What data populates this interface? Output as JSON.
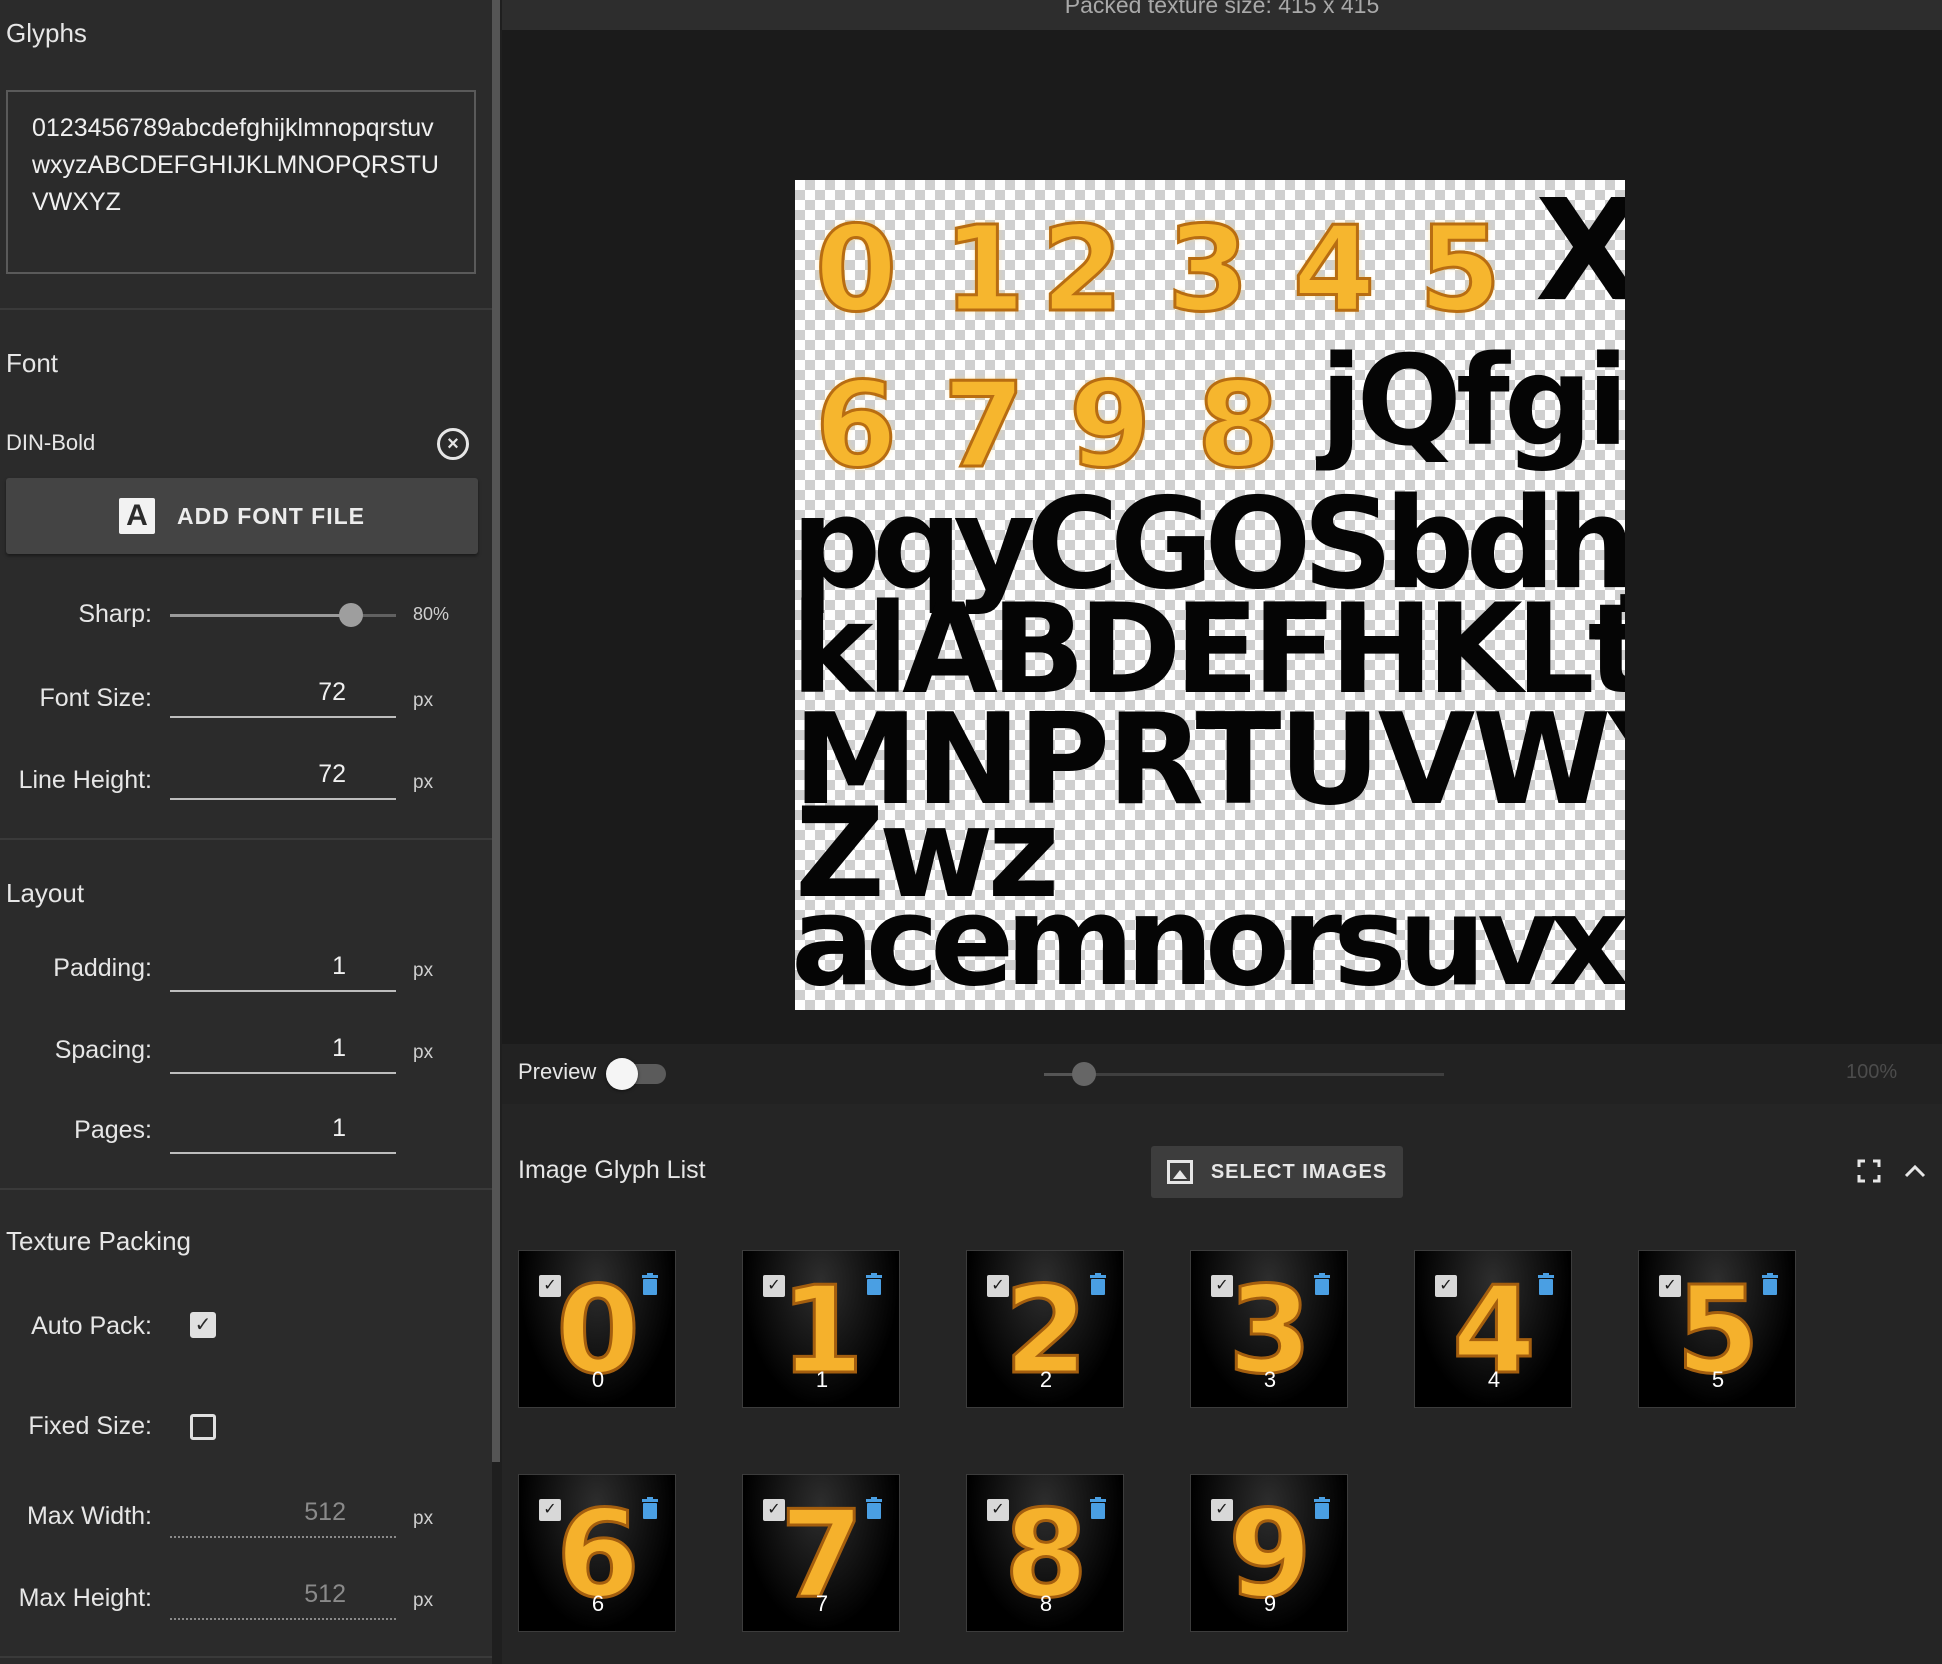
{
  "sidebar": {
    "glyphs": {
      "title": "Glyphs",
      "text": "0123456789abcdefghijklmnopqrstuvwxyzABCDEFGHIJKLMNOPQRSTUVWXYZ"
    },
    "font": {
      "title": "Font",
      "font_name": "DIN-Bold",
      "add_font_label": "ADD FONT FILE",
      "add_font_icon": "A",
      "sharp": {
        "label": "Sharp:",
        "value": "80%",
        "level": 0.8
      },
      "font_size": {
        "label": "Font Size:",
        "value": "72",
        "unit": "px"
      },
      "line_height": {
        "label": "Line Height:",
        "value": "72",
        "unit": "px"
      }
    },
    "layout": {
      "title": "Layout",
      "padding": {
        "label": "Padding:",
        "value": "1",
        "unit": "px"
      },
      "spacing": {
        "label": "Spacing:",
        "value": "1",
        "unit": "px"
      },
      "pages": {
        "label": "Pages:",
        "value": "1"
      }
    },
    "texture_packing": {
      "title": "Texture Packing",
      "auto_pack": {
        "label": "Auto Pack:",
        "checked": true
      },
      "fixed_size": {
        "label": "Fixed Size:",
        "checked": false
      },
      "max_width": {
        "label": "Max Width:",
        "value": "512",
        "unit": "px"
      },
      "max_height": {
        "label": "Max Height:",
        "value": "512",
        "unit": "px"
      }
    }
  },
  "preview": {
    "packed_size": "Packed texture size: 415 x 415",
    "texture_rows": {
      "row1_digits": [
        "0",
        "1",
        "2",
        "3",
        "4",
        "5"
      ],
      "row1_tail": "X",
      "row2_digits": [
        "6",
        "7",
        "9",
        "8"
      ],
      "row2_tail": "jQfgil",
      "row3": "pqyCGOSbdhJ",
      "row4": "klABDEFHKLt",
      "row5": "MNPRTUVWY",
      "row6": "Zwz",
      "row7": "acemnorsuvx"
    },
    "preview_label": "Preview",
    "preview_enabled": false,
    "zoom_label": "100%",
    "zoom_level": 0.1
  },
  "glyph_list": {
    "title": "Image Glyph List",
    "select_images_label": "SELECT IMAGES",
    "icons": {
      "select_images": "image-gallery-icon",
      "fullscreen": "fullscreen-icon",
      "collapse": "chevron-up-icon",
      "check": "checkbox-checked-icon",
      "delete": "trash-icon"
    },
    "accent_color": "#4a9fe3",
    "items": [
      {
        "char": "0",
        "label": "0",
        "checked": true
      },
      {
        "char": "1",
        "label": "1",
        "checked": true
      },
      {
        "char": "2",
        "label": "2",
        "checked": true
      },
      {
        "char": "3",
        "label": "3",
        "checked": true
      },
      {
        "char": "4",
        "label": "4",
        "checked": true
      },
      {
        "char": "5",
        "label": "5",
        "checked": true
      },
      {
        "char": "6",
        "label": "6",
        "checked": true
      },
      {
        "char": "7",
        "label": "7",
        "checked": true
      },
      {
        "char": "8",
        "label": "8",
        "checked": true
      },
      {
        "char": "9",
        "label": "9",
        "checked": true
      }
    ]
  }
}
